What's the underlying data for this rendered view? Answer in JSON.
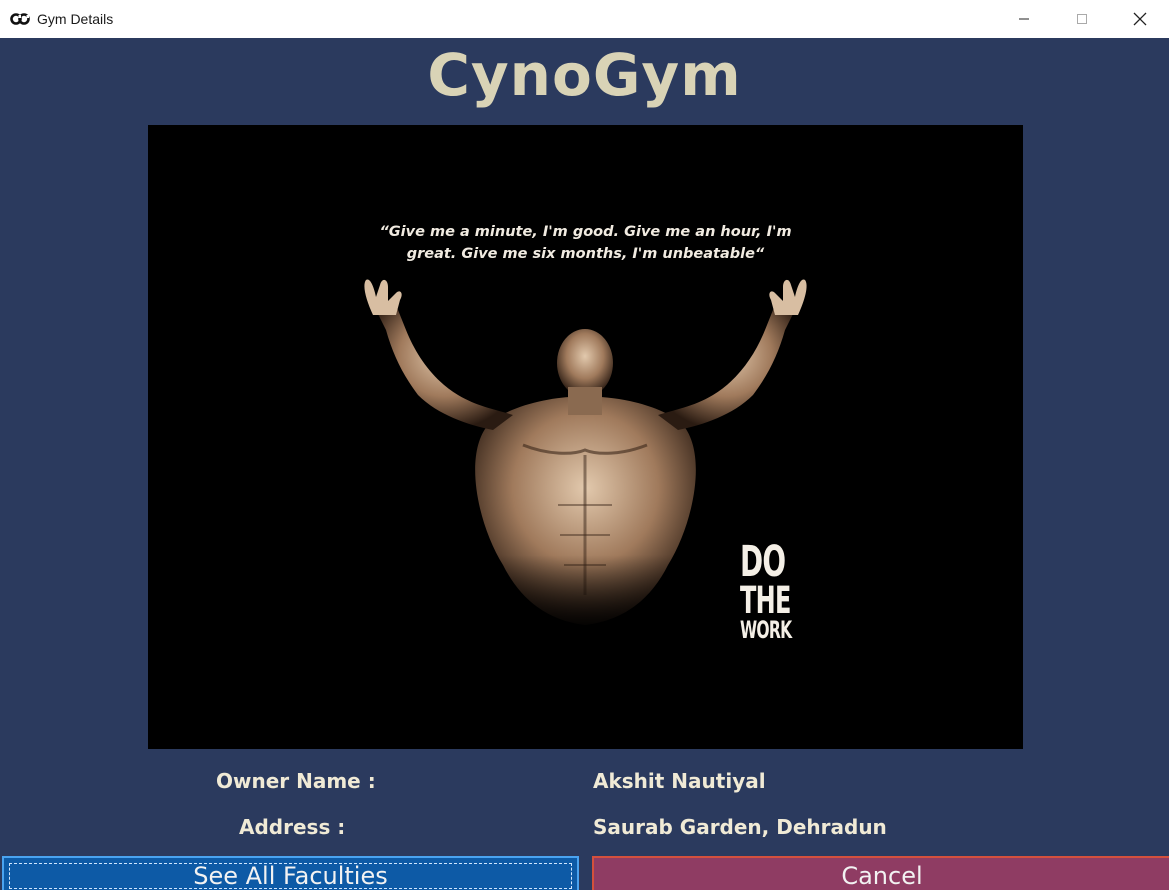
{
  "window": {
    "title": "Gym Details",
    "icon": "cg-logo-icon",
    "controls": [
      "minimize-icon",
      "maximize-icon",
      "close-icon"
    ]
  },
  "header": {
    "title": "CynoGym"
  },
  "poster": {
    "quote_line1": "“Give me a minute, I'm good. Give me an hour, I'm",
    "quote_line2": "great. Give me six months, I'm unbeatable“",
    "motto_line1": "DO",
    "motto_line2": "THE",
    "motto_line3": "WORK"
  },
  "info": {
    "owner_label": "Owner Name :",
    "owner_value": "Akshit Nautiyal",
    "address_label": "Address :",
    "address_value": "Saurab Garden, Dehradun"
  },
  "buttons": {
    "faculties_label": "See All Faculties",
    "cancel_label": "Cancel"
  },
  "colors": {
    "background": "#2b3a5e",
    "title": "#d9d3b6",
    "faculties_button": "#0d5aa6",
    "cancel_button": "#8f3c63"
  }
}
